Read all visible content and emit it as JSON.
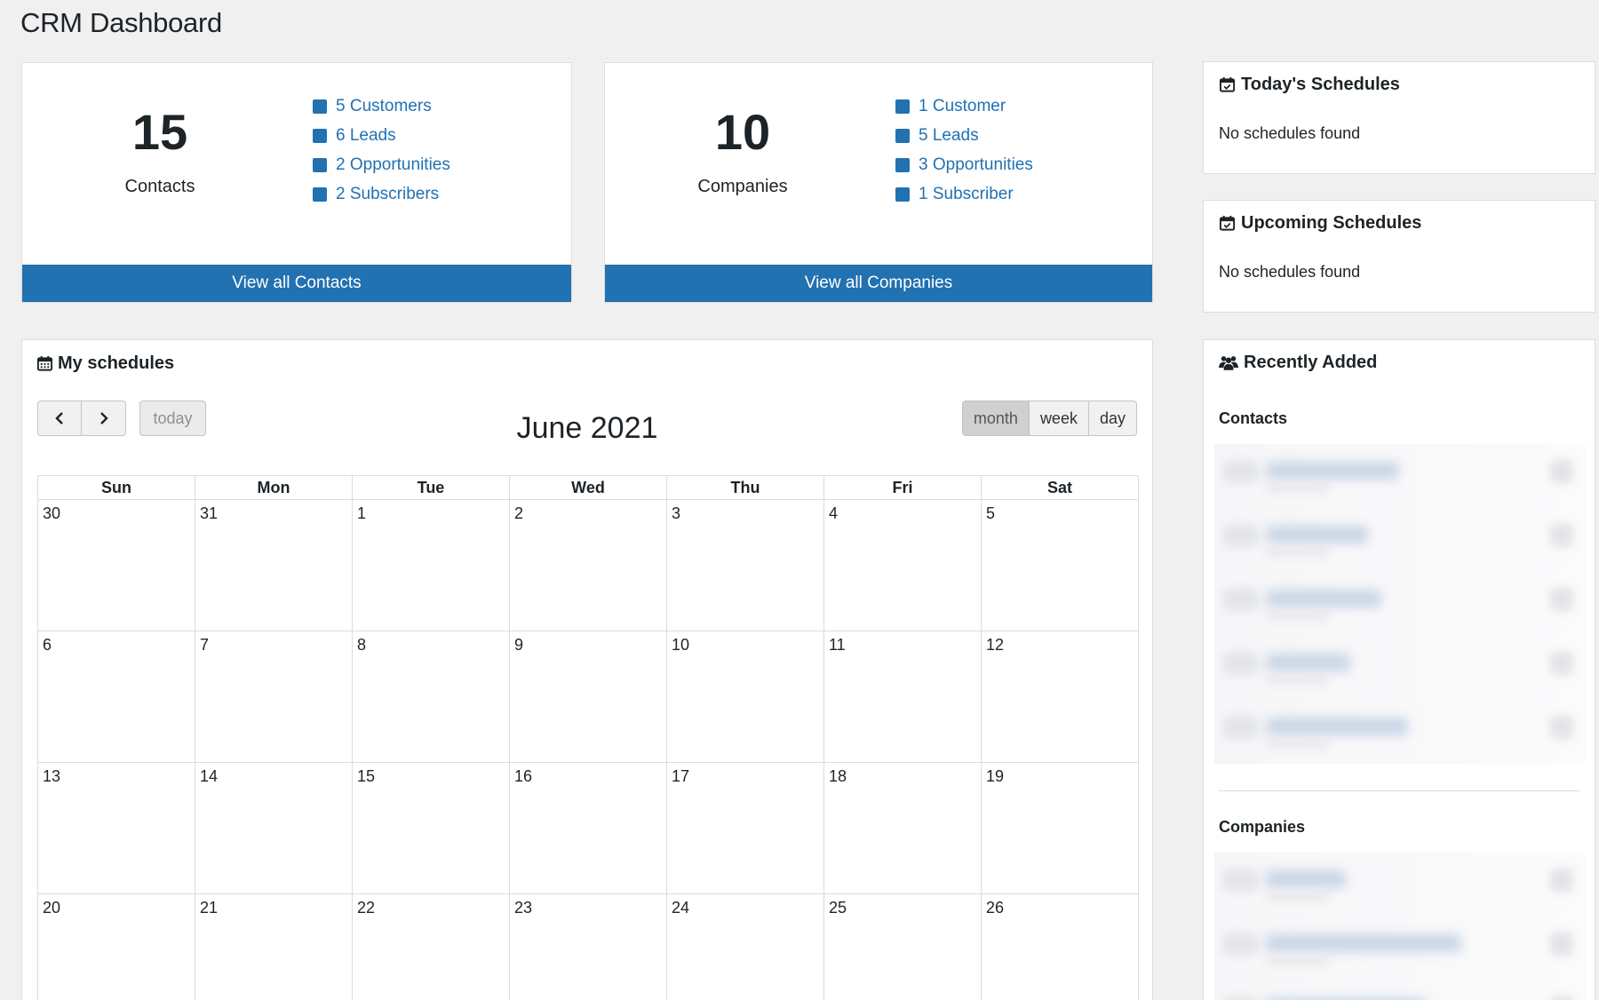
{
  "page": {
    "title": "CRM Dashboard"
  },
  "contacts_card": {
    "count": "15",
    "label": "Contacts",
    "items": [
      "5 Customers",
      "6 Leads",
      "2 Opportunities",
      "2 Subscribers"
    ],
    "button": "View all Contacts"
  },
  "companies_card": {
    "count": "10",
    "label": "Companies",
    "items": [
      "1 Customer",
      "5 Leads",
      "3 Opportunities",
      "1 Subscriber"
    ],
    "button": "View all Companies"
  },
  "todays_schedules": {
    "title": "Today's Schedules",
    "empty": "No schedules found"
  },
  "upcoming_schedules": {
    "title": "Upcoming Schedules",
    "empty": "No schedules found"
  },
  "recently_added": {
    "title": "Recently Added",
    "contacts_heading": "Contacts",
    "companies_heading": "Companies"
  },
  "schedules": {
    "title": "My schedules",
    "nav": {
      "prev": "‹",
      "next": "›",
      "today": "today"
    },
    "views": [
      "month",
      "week",
      "day"
    ],
    "active_view": "month",
    "month_title": "June 2021",
    "weekdays": [
      "Sun",
      "Mon",
      "Tue",
      "Wed",
      "Thu",
      "Fri",
      "Sat"
    ],
    "weeks": [
      [
        "30",
        "31",
        "1",
        "2",
        "3",
        "4",
        "5"
      ],
      [
        "6",
        "7",
        "8",
        "9",
        "10",
        "11",
        "12"
      ],
      [
        "13",
        "14",
        "15",
        "16",
        "17",
        "18",
        "19"
      ],
      [
        "20",
        "21",
        "22",
        "23",
        "24",
        "25",
        "26"
      ]
    ]
  },
  "colors": {
    "primary": "#2271b1",
    "background": "#f0f0f1"
  }
}
